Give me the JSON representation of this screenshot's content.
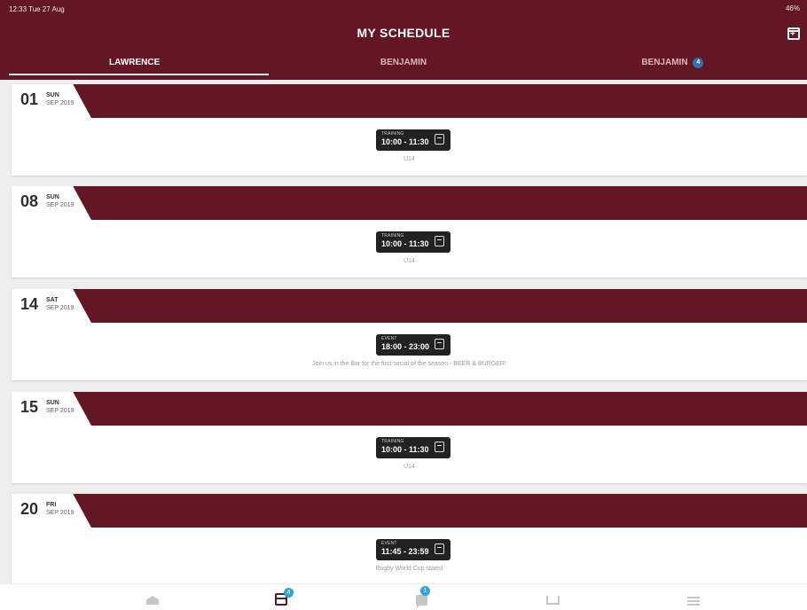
{
  "status": {
    "time_date": "12:33 Tue 27 Aug",
    "battery": "46%"
  },
  "header": {
    "title": "MY SCHEDULE",
    "tabs": [
      {
        "label": "LAWRENCE"
      },
      {
        "label": "BENJAMIN"
      },
      {
        "label": "BENJAMIN",
        "badge": "4"
      }
    ]
  },
  "days": [
    {
      "num": "01",
      "dow": "SUN",
      "month": "SEP 2019",
      "entry_type": "TRAINING",
      "time": "10:00 - 11:30",
      "note": "U14"
    },
    {
      "num": "08",
      "dow": "SUN",
      "month": "SEP 2019",
      "entry_type": "TRAINING",
      "time": "10:00 - 11:30",
      "note": "U14"
    },
    {
      "num": "14",
      "dow": "SAT",
      "month": "SEP 2019",
      "entry_type": "EVENT",
      "time": "18:00 - 23:00",
      "note": "Join us in the Bar for the first social of the season - BEER & BURGER!"
    },
    {
      "num": "15",
      "dow": "SUN",
      "month": "SEP 2019",
      "entry_type": "TRAINING",
      "time": "10:00 - 11:30",
      "note": "U14"
    },
    {
      "num": "20",
      "dow": "FRI",
      "month": "SEP 2019",
      "entry_type": "EVENT",
      "time": "11:45 - 23:59",
      "note": "Rugby World Cup starts!"
    }
  ],
  "bottom_nav": {
    "calendar_badge": "4",
    "chat_badge": "1"
  },
  "colors": {
    "brand": "#631624",
    "badge": "#2aa7de"
  }
}
